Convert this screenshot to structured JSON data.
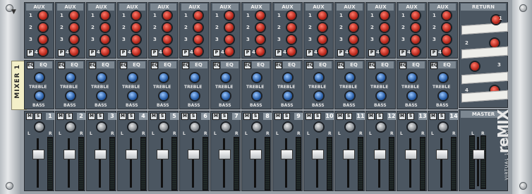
{
  "mixer": {
    "device_label": "MIXER 1",
    "fold_icon": "triangle-down",
    "aux_header": "AUX",
    "eq_header": "EQ",
    "treble_label": "TREBLE",
    "bass_label": "BASS",
    "mute_label": "M",
    "solo_label": "S",
    "prefader_label": "P",
    "eq_toggle_label": "EQ",
    "pan_left": "L",
    "pan_right": "R",
    "aux_numbers": [
      "1",
      "2",
      "3",
      "4"
    ],
    "channels": [
      "1",
      "2",
      "3",
      "4",
      "5",
      "6",
      "7",
      "8",
      "9",
      "10",
      "11",
      "12",
      "13",
      "14"
    ]
  },
  "return": {
    "header": "RETURN",
    "numbers": [
      "1",
      "2",
      "3",
      "4"
    ]
  },
  "master": {
    "header": "MASTER",
    "left": "L",
    "right": "R"
  },
  "brand": {
    "logo": "reMIX",
    "model": "VIRTUAL 14:2 MIXER"
  },
  "colors": {
    "panel": "#4b5661",
    "aux_knob": "#b8281c",
    "eq_knob": "#2a5fa8"
  }
}
